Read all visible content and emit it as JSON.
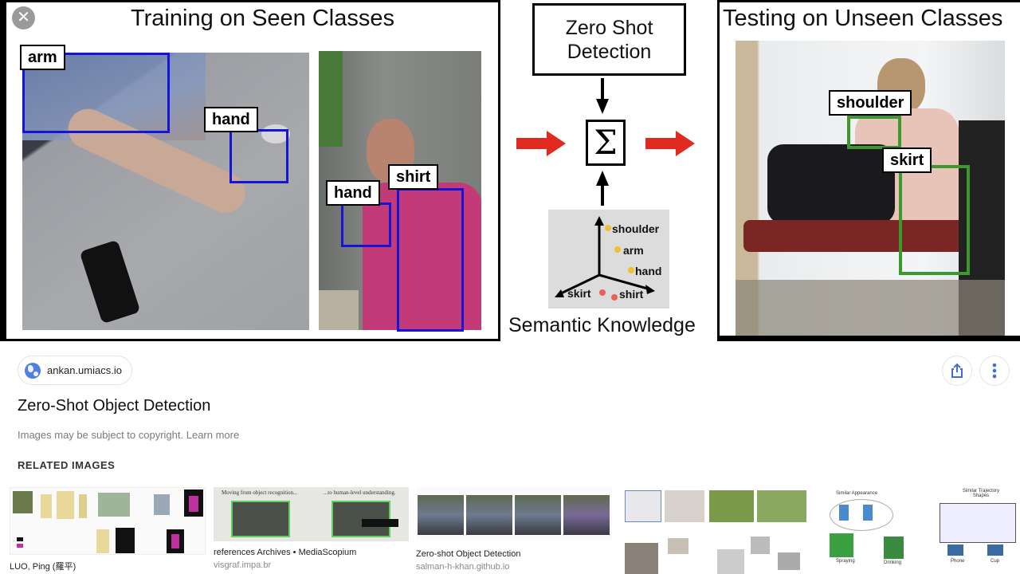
{
  "viewer": {
    "close_label": "✕",
    "training_panel": {
      "title": "Training on Seen Classes",
      "labels": [
        "arm",
        "hand",
        "hand",
        "shirt"
      ]
    },
    "middle_panel": {
      "box_title_line1": "Zero Shot",
      "box_title_line2": "Detection",
      "sigma": "Σ",
      "semantic_words": [
        "shoulder",
        "arm",
        "hand",
        "skirt",
        "shirt"
      ],
      "caption": "Semantic Knowledge"
    },
    "testing_panel": {
      "title": "Testing on Unseen Classes",
      "labels": [
        "shoulder",
        "skirt"
      ]
    },
    "colors": {
      "seen_box": "#1515d8",
      "unseen_box": "#3a9a2c",
      "flow_arrow": "#e02a20",
      "seen_point": "#f0c030",
      "unseen_point": "#e8605a"
    }
  },
  "sheet": {
    "source": "ankan.umiacs.io",
    "share_icon": "share-icon",
    "more_icon": "more-vertical-icon",
    "title": "Zero-Shot Object Detection",
    "copyright_text": "Images may be subject to copyright.",
    "learn_more": "Learn more",
    "related_heading": "RELATED IMAGES",
    "related": [
      {
        "title": "LUO, Ping (羅平)",
        "site": ""
      },
      {
        "title": "references Archives • MediaScopium",
        "site": "visgraf.impa.br",
        "thumb_caption_left": "Moving from object recognition...",
        "thumb_caption_right": "...to human-level understanding."
      },
      {
        "title": "Zero-shot Object Detection",
        "site": "salman-h-khan.github.io"
      },
      {
        "title": "",
        "site": ""
      },
      {
        "title": "",
        "site": "",
        "thumb_caption_left": "Similar Appearance",
        "thumb_caption_right": "Similar Trajectory Shapes",
        "thumb_labels": [
          "Spraying",
          "Drinking",
          "Phone",
          "Cup"
        ]
      }
    ]
  }
}
